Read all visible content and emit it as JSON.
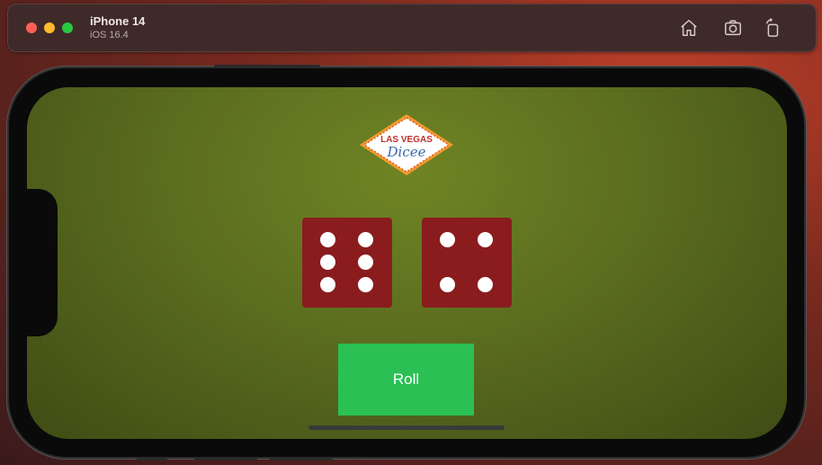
{
  "simulator": {
    "device_name": "iPhone 14",
    "os_version": "iOS 16.4",
    "toolbar_icons": [
      "home-icon",
      "screenshot-icon",
      "rotate-icon"
    ]
  },
  "app": {
    "logo": {
      "line1": "LAS VEGAS",
      "line2": "Dicee"
    },
    "dice": [
      {
        "value": 6,
        "color": "#8a1c1e"
      },
      {
        "value": 4,
        "color": "#8a1c1e"
      }
    ],
    "roll_label": "Roll",
    "roll_color": "#2ac054",
    "felt_color": "#5b6d1f"
  }
}
